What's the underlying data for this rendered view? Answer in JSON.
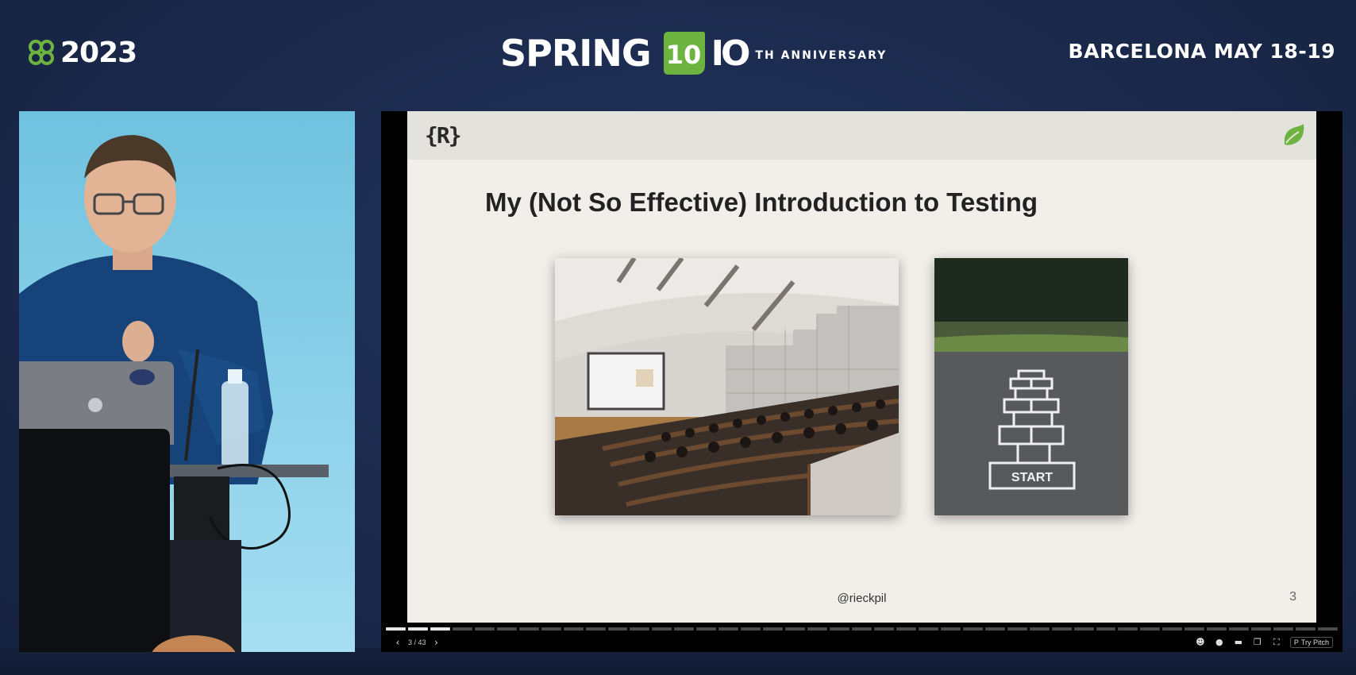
{
  "banner": {
    "event_year": "2023",
    "event_name": "SPRING",
    "badge_number": "10",
    "anniversary": "TH ANNIVERSARY",
    "location_date": "BARCELONA MAY 18-19"
  },
  "slide": {
    "logo_text": "{R}",
    "title": "My (Not So Effective) Introduction to Testing",
    "handle": "@rieckpil",
    "number": "3",
    "photos": [
      {
        "name": "lecture-hall-photo"
      },
      {
        "name": "hopscotch-start-photo",
        "hopscotch_label": "START"
      }
    ]
  },
  "player": {
    "prev_icon": "‹",
    "next_icon": "›",
    "page_indicator": "3 / 43",
    "progress": {
      "current": 3,
      "total": 43
    },
    "controls": [
      {
        "name": "emoji-icon",
        "glyph": "☻"
      },
      {
        "name": "comment-icon",
        "glyph": "●"
      },
      {
        "name": "present-icon",
        "glyph": "▬"
      },
      {
        "name": "window-icon",
        "glyph": "❐"
      },
      {
        "name": "fullscreen-icon",
        "glyph": "⛶"
      }
    ],
    "try_pitch": "Try Pitch",
    "try_pitch_icon": "P"
  },
  "colors": {
    "stage_bg": "#1b2a4d",
    "spring_green": "#6db33f",
    "slide_bg": "#f2efeb"
  }
}
